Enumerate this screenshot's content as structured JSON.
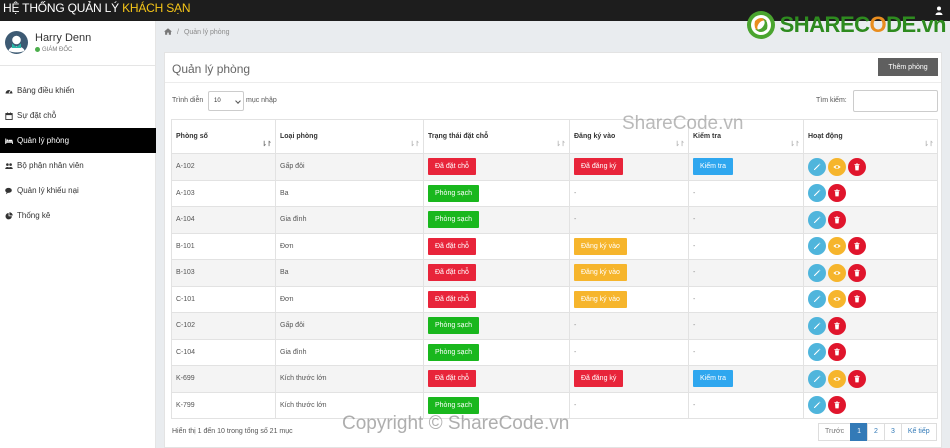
{
  "app": {
    "title_prefix": "HỆ THỐNG QUẢN LÝ ",
    "title_accent": "KHÁCH SẠN",
    "accent_color": "#f5c518"
  },
  "watermark": {
    "logo_text_1": "SHAREC",
    "logo_text_o": "O",
    "logo_text_2": "DE.vn",
    "center_text": "ShareCode.vn",
    "bottom_text": "Copyright © ShareCode.vn"
  },
  "profile": {
    "name": "Harry Denn",
    "role": "Giám đốc"
  },
  "sidebar": {
    "items": [
      {
        "label": "Bảng điều khiển",
        "icon": "dashboard-icon"
      },
      {
        "label": "Sự đặt chỗ",
        "icon": "calendar-icon"
      },
      {
        "label": "Quản lý phòng",
        "icon": "bed-icon",
        "active": true
      },
      {
        "label": "Bộ phận nhân viên",
        "icon": "users-icon"
      },
      {
        "label": "Quản lý khiếu nại",
        "icon": "comments-icon"
      },
      {
        "label": "Thống kê",
        "icon": "pie-chart-icon"
      }
    ]
  },
  "breadcrumb": {
    "current": "Quản lý phòng"
  },
  "panel": {
    "title": "Quản lý phòng",
    "add_button": "Thêm phòng"
  },
  "table_controls": {
    "show_label": "Trình diễn",
    "length_value": "10",
    "entries_label": "mục nhập",
    "search_label": "Tìm kiếm:",
    "search_value": ""
  },
  "table": {
    "headers": [
      "Phòng số",
      "Loại phòng",
      "Trạng thái đặt chỗ",
      "Đăng ký vào",
      "Kiểm tra",
      "Hoạt động"
    ],
    "rows": [
      {
        "room": "A-102",
        "type": "Gấp đôi",
        "booking": "Đã đặt chỗ",
        "booking_color": "red",
        "checkin": "Đã đăng ký",
        "checkin_color": "red",
        "checkout": "Kiểm tra",
        "checkout_color": "blue",
        "view": true
      },
      {
        "room": "A-103",
        "type": "Ba",
        "booking": "Phòng sạch",
        "booking_color": "green",
        "checkin": "-",
        "checkin_color": "",
        "checkout": "-",
        "checkout_color": "",
        "view": false
      },
      {
        "room": "A-104",
        "type": "Gia đình",
        "booking": "Phòng sạch",
        "booking_color": "green",
        "checkin": "-",
        "checkin_color": "",
        "checkout": "-",
        "checkout_color": "",
        "view": false
      },
      {
        "room": "B-101",
        "type": "Đơn",
        "booking": "Đã đặt chỗ",
        "booking_color": "red",
        "checkin": "Đăng ký vào",
        "checkin_color": "orange",
        "checkout": "-",
        "checkout_color": "",
        "view": true
      },
      {
        "room": "B-103",
        "type": "Ba",
        "booking": "Đã đặt chỗ",
        "booking_color": "red",
        "checkin": "Đăng ký vào",
        "checkin_color": "orange",
        "checkout": "-",
        "checkout_color": "",
        "view": true
      },
      {
        "room": "C-101",
        "type": "Đơn",
        "booking": "Đã đặt chỗ",
        "booking_color": "red",
        "checkin": "Đăng ký vào",
        "checkin_color": "orange",
        "checkout": "-",
        "checkout_color": "",
        "view": true
      },
      {
        "room": "C-102",
        "type": "Gấp đôi",
        "booking": "Phòng sạch",
        "booking_color": "green",
        "checkin": "-",
        "checkin_color": "",
        "checkout": "-",
        "checkout_color": "",
        "view": false
      },
      {
        "room": "C-104",
        "type": "Gia đình",
        "booking": "Phòng sạch",
        "booking_color": "green",
        "checkin": "-",
        "checkin_color": "",
        "checkout": "-",
        "checkout_color": "",
        "view": false
      },
      {
        "room": "K-699",
        "type": "Kích thước lớn",
        "booking": "Đã đặt chỗ",
        "booking_color": "red",
        "checkin": "Đã đăng ký",
        "checkin_color": "red",
        "checkout": "Kiểm tra",
        "checkout_color": "blue",
        "view": true
      },
      {
        "room": "K-799",
        "type": "Kích thước lớn",
        "booking": "Phòng sạch",
        "booking_color": "green",
        "checkin": "-",
        "checkin_color": "",
        "checkout": "-",
        "checkout_color": "",
        "view": false
      }
    ]
  },
  "footer": {
    "info": "Hiển thị 1 đến 10 trong tổng số 21 mục",
    "pagination": {
      "prev": "Trước",
      "pages": [
        "1",
        "2",
        "3"
      ],
      "current": "1",
      "next": "Kế tiếp"
    }
  },
  "colors": {
    "red": "#e8243a",
    "green": "#19b71d",
    "orange": "#f6b52c",
    "blue": "#2fa7ef"
  }
}
